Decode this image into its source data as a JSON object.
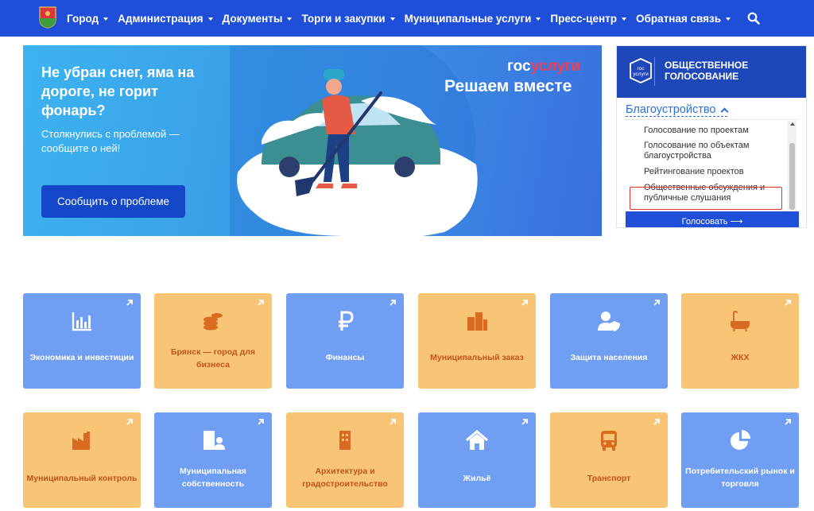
{
  "nav": {
    "items": [
      "Город",
      "Администрация",
      "Документы",
      "Торги и закупки",
      "Муниципальные услуги",
      "Пресс-центр",
      "Обратная связь"
    ]
  },
  "banner": {
    "title": "Не убран снег, яма на дороге, не горит фонарь?",
    "subtitle": "Столкнулись с проблемой — сообщите о ней!",
    "button": "Сообщить о проблеме",
    "brand_part1": "гос",
    "brand_part2": "услуги",
    "slogan": "Решаем вместе"
  },
  "voting": {
    "logo_text_1": "гос",
    "logo_text_2": "услуги",
    "title_line1": "ОБЩЕСТВЕННОЕ",
    "title_line2": "ГОЛОСОВАНИЕ",
    "category": "Благоустройство",
    "options": [
      "Голосование по проектам",
      "Голосование по объектам благоустройства",
      "Рейтингование проектов",
      "Общественные обсуждения и публичные слушания"
    ],
    "button": "Голосовать"
  },
  "tiles": [
    {
      "label": "Экономика и инвестиции",
      "icon": "chart-bar-icon"
    },
    {
      "label": "Брянск — город для бизнеса",
      "icon": "coins-icon"
    },
    {
      "label": "Финансы",
      "icon": "ruble-icon"
    },
    {
      "label": "Муниципальный заказ",
      "icon": "buildings-icon"
    },
    {
      "label": "Защита населения",
      "icon": "user-shield-icon"
    },
    {
      "label": "ЖКХ",
      "icon": "bath-icon"
    },
    {
      "label": "Муниципальный контроль",
      "icon": "industry-icon"
    },
    {
      "label": "Муниципальная собственность",
      "icon": "building-user-icon"
    },
    {
      "label": "Архитектура и градостроительство",
      "icon": "building-icon"
    },
    {
      "label": "Жильё",
      "icon": "home-icon"
    },
    {
      "label": "Транспорт",
      "icon": "bus-icon"
    },
    {
      "label": "Потребительский рынок и торговля",
      "icon": "pie-chart-icon"
    }
  ],
  "colors": {
    "nav": "#1f4fd9",
    "tile_blue": "#6f9ef3",
    "tile_orange": "#f8c576",
    "tile_orange_text": "#c1541a",
    "highlight_border": "#e0322f"
  }
}
